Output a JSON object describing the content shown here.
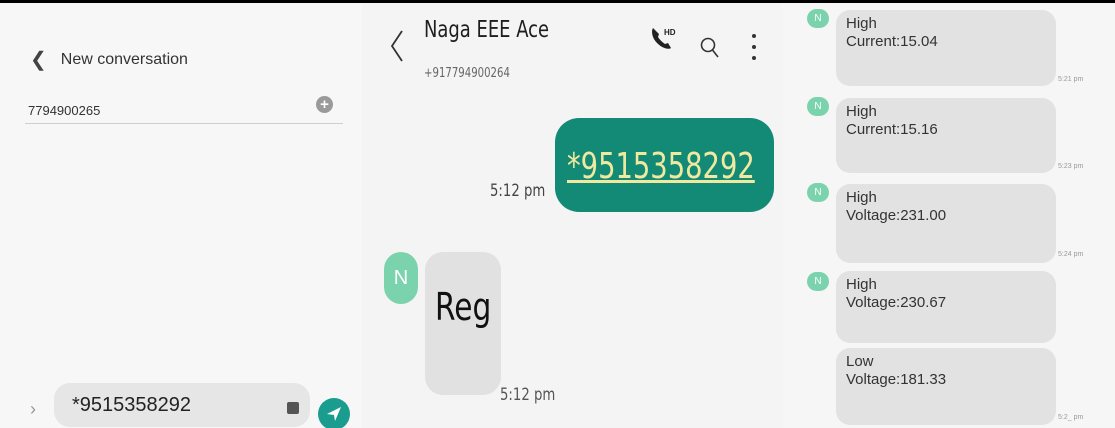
{
  "new_conversation": {
    "title": "New conversation",
    "recipient": "7794900265",
    "composer_text": "*9515358292"
  },
  "conversation": {
    "contact_name": "Naga EEE Ace",
    "contact_number": "+917794900264",
    "messages": [
      {
        "direction": "sent",
        "text": "*9515358292",
        "time": "5:12 pm"
      },
      {
        "direction": "received",
        "avatar": "N",
        "text": "Reg",
        "time": "5:12 pm"
      }
    ]
  },
  "alerts": {
    "avatar": "N",
    "messages": [
      {
        "text": "High\nCurrent:15.04",
        "time": "5:21 pm"
      },
      {
        "text": "High\nCurrent:15.16",
        "time": "5:23 pm"
      },
      {
        "text": "High\nVoltage:231.00",
        "time": "5:24 pm"
      },
      {
        "text": "High\nVoltage:230.67",
        "time": ""
      },
      {
        "text": "Low\nVoltage:181.33",
        "time": "5:2_ pm"
      }
    ]
  },
  "colors": {
    "accent": "#138a76",
    "avatar": "#7bd3ad",
    "bubble": "#e2e2e2"
  }
}
